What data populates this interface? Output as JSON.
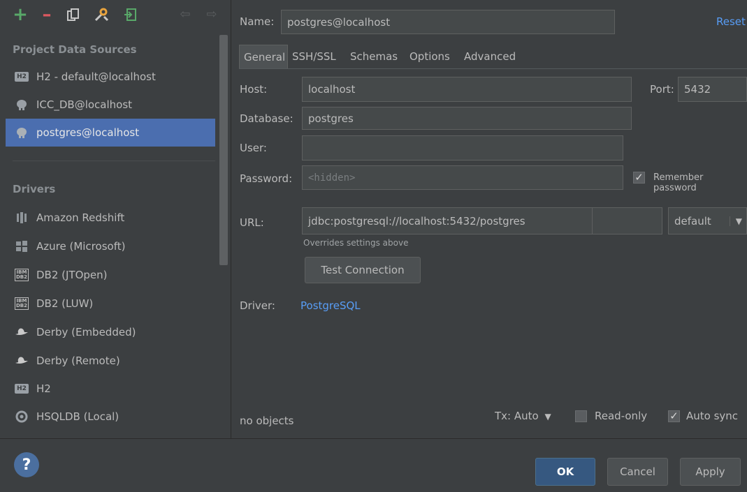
{
  "toolbar": {
    "icons": [
      "add-icon",
      "remove-icon",
      "duplicate-icon",
      "edit-properties-icon",
      "import-icon",
      "back-icon",
      "forward-icon"
    ]
  },
  "left": {
    "project_title": "Project Data Sources",
    "project_sources": [
      {
        "label": "H2 - default@localhost",
        "icon": "h2-icon",
        "badge": "H2"
      },
      {
        "label": "ICC_DB@localhost",
        "icon": "postgres-elephant-icon"
      },
      {
        "label": "postgres@localhost",
        "icon": "postgres-elephant-icon",
        "selected": true
      }
    ],
    "drivers_title": "Drivers",
    "drivers": [
      {
        "label": "Amazon Redshift",
        "icon": "redshift-icon"
      },
      {
        "label": "Azure (Microsoft)",
        "icon": "azure-windows-icon"
      },
      {
        "label": "DB2 (JTOpen)",
        "icon": "ibm-db2-icon",
        "badge_top": "IBM",
        "badge_bottom": "DB2"
      },
      {
        "label": "DB2 (LUW)",
        "icon": "ibm-db2-icon",
        "badge_top": "IBM",
        "badge_bottom": "DB2"
      },
      {
        "label": "Derby (Embedded)",
        "icon": "derby-hat-icon"
      },
      {
        "label": "Derby (Remote)",
        "icon": "derby-hat-icon"
      },
      {
        "label": "H2",
        "icon": "h2-icon",
        "badge": "H2"
      },
      {
        "label": "HSQLDB (Local)",
        "icon": "hsqldb-icon"
      }
    ]
  },
  "form": {
    "name_label": "Name:",
    "name_value": "postgres@localhost",
    "reset_label": "Reset",
    "tabs": [
      "General",
      "SSH/SSL",
      "Schemas",
      "Options",
      "Advanced"
    ],
    "active_tab": "General",
    "host_label": "Host:",
    "host_value": "localhost",
    "port_label": "Port:",
    "port_value": "5432",
    "database_label": "Database:",
    "database_value": "postgres",
    "user_label": "User:",
    "user_value": "",
    "password_label": "Password:",
    "password_placeholder": "<hidden>",
    "remember_password_label": "Remember password",
    "remember_password_checked": true,
    "url_label": "URL:",
    "url_value": "jdbc:postgresql://localhost:5432/postgres",
    "url_mode": "default",
    "url_hint": "Overrides settings above",
    "test_connection_label": "Test Connection",
    "driver_label": "Driver:",
    "driver_link": "PostgreSQL",
    "objects_status": "no objects",
    "tx_label": "Tx: Auto",
    "readonly_label": "Read-only",
    "readonly_checked": false,
    "autosync_label": "Auto sync",
    "autosync_checked": true
  },
  "footer": {
    "help_label": "?",
    "ok_label": "OK",
    "cancel_label": "Cancel",
    "apply_label": "Apply"
  },
  "colors": {
    "background": "#3c3f41",
    "selection": "#4b6eaf",
    "link": "#589df6",
    "add_green": "#59a869",
    "remove_red": "#db5860",
    "primary_button": "#365880"
  }
}
